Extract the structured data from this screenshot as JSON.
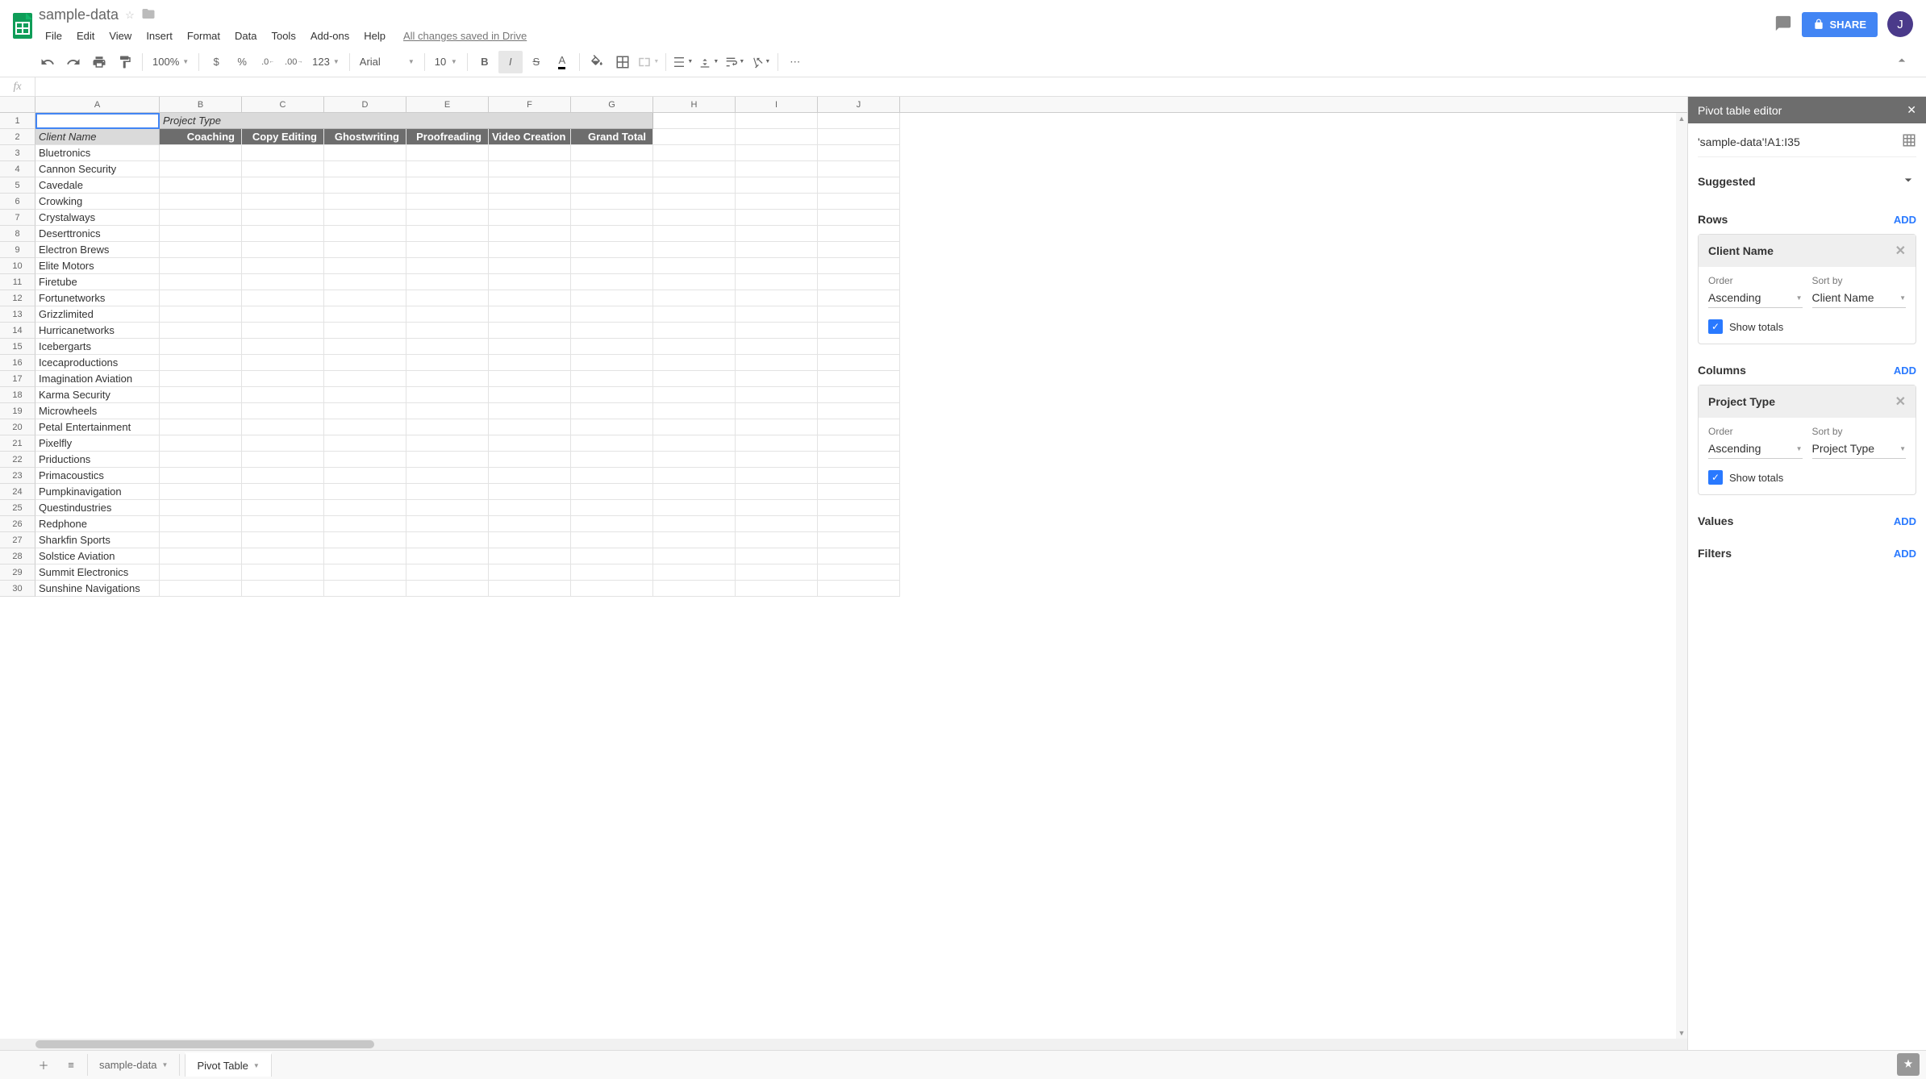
{
  "doc": {
    "title": "sample-data",
    "save_status": "All changes saved in Drive",
    "avatar_initial": "J"
  },
  "menus": [
    "File",
    "Edit",
    "View",
    "Insert",
    "Format",
    "Data",
    "Tools",
    "Add-ons",
    "Help"
  ],
  "share_label": "SHARE",
  "toolbar": {
    "zoom": "100%",
    "font": "Arial",
    "font_size": "10"
  },
  "fx_label": "fx",
  "columns": [
    "A",
    "B",
    "C",
    "D",
    "E",
    "F",
    "G",
    "H",
    "I",
    "J"
  ],
  "pivot_headers_row1": {
    "A": "",
    "B": "Project Type"
  },
  "pivot_headers_row2": [
    "Client Name",
    "Coaching",
    "Copy Editing",
    "Ghostwriting",
    "Proofreading",
    "Video Creation",
    "Grand Total"
  ],
  "clients": [
    "Bluetronics",
    "Cannon Security",
    "Cavedale",
    "Crowking",
    "Crystalways",
    "Deserttronics",
    "Electron Brews",
    "Elite Motors",
    "Firetube",
    "Fortunetworks",
    "Grizzlimited",
    "Hurricanetworks",
    "Icebergarts",
    "Icecaproductions",
    "Imagination Aviation",
    "Karma Security",
    "Microwheels",
    "Petal Entertainment",
    "Pixelfly",
    "Priductions",
    "Primacoustics",
    "Pumpkinavigation",
    "Questindustries",
    "Redphone",
    "Sharkfin Sports",
    "Solstice Aviation",
    "Summit Electronics",
    "Sunshine Navigations"
  ],
  "tabs": {
    "sheet1": "sample-data",
    "sheet2": "Pivot Table"
  },
  "panel": {
    "title": "Pivot table editor",
    "range": "'sample-data'!A1:I35",
    "suggested": "Suggested",
    "rows": {
      "title": "Rows",
      "add": "ADD",
      "field": "Client Name",
      "order_label": "Order",
      "order_value": "Ascending",
      "sort_label": "Sort by",
      "sort_value": "Client Name",
      "show_totals": "Show totals"
    },
    "cols": {
      "title": "Columns",
      "add": "ADD",
      "field": "Project Type",
      "order_label": "Order",
      "order_value": "Ascending",
      "sort_label": "Sort by",
      "sort_value": "Project Type",
      "show_totals": "Show totals"
    },
    "values": {
      "title": "Values",
      "add": "ADD"
    },
    "filters": {
      "title": "Filters",
      "add": "ADD"
    }
  }
}
